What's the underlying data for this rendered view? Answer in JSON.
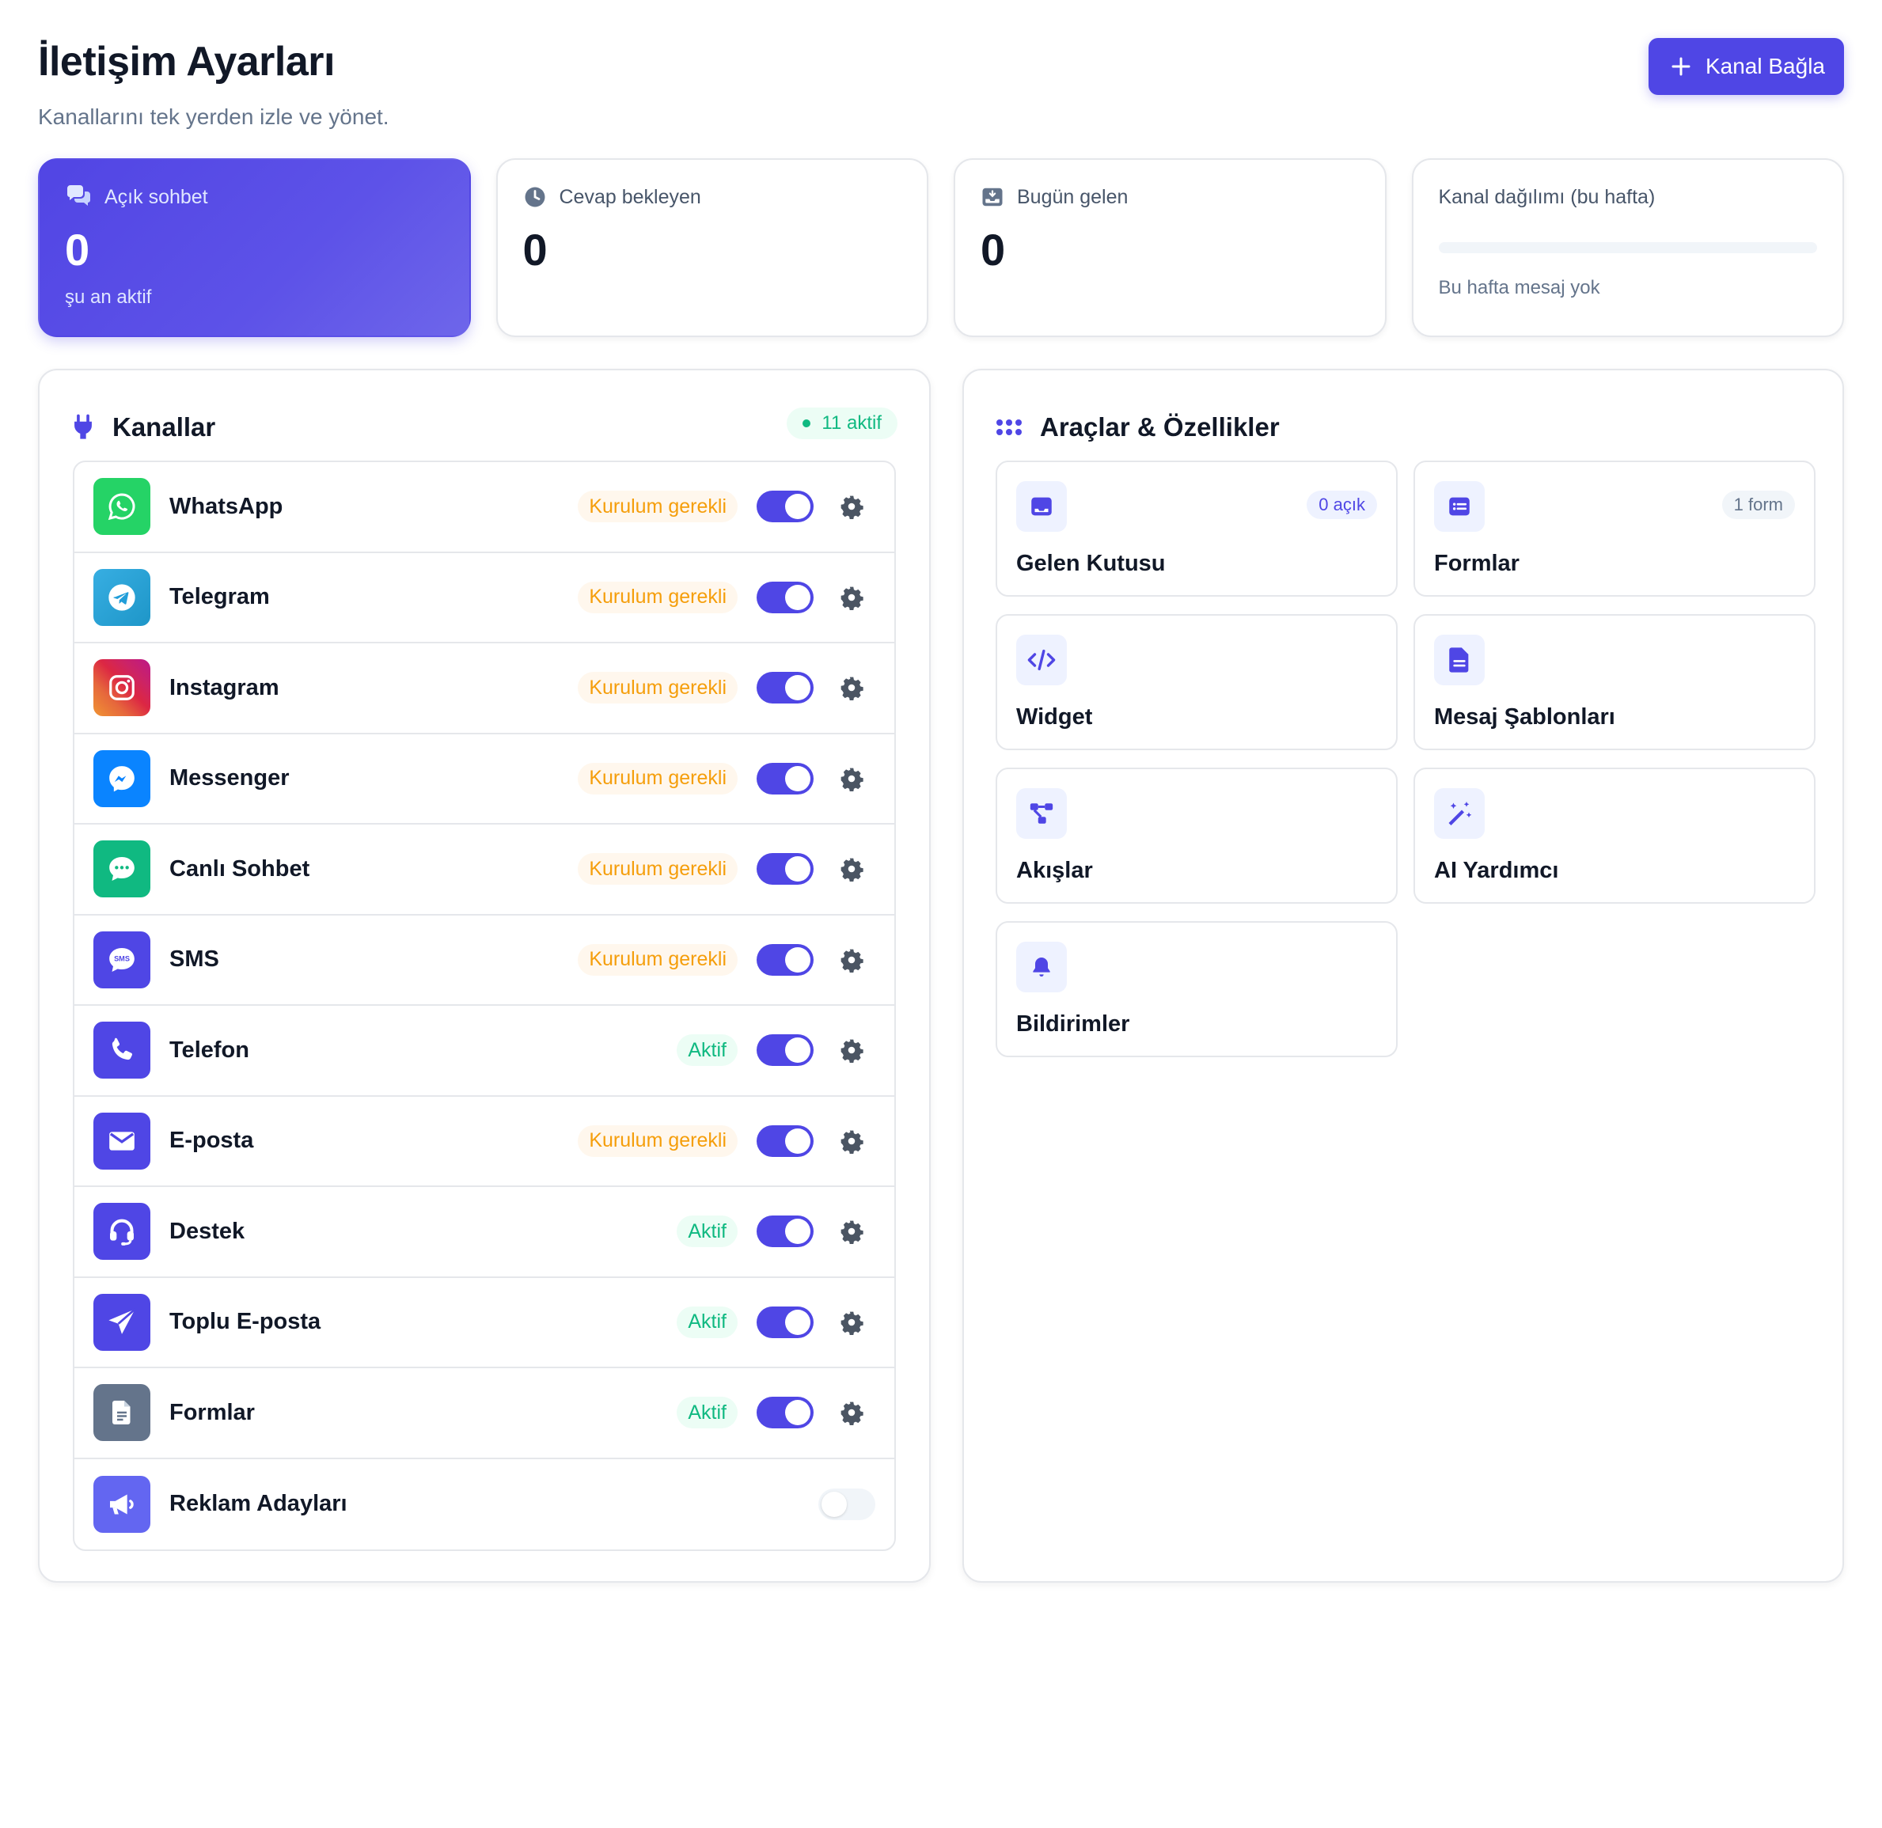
{
  "page": {
    "title": "İletişim Ayarları",
    "subtitle": "Kanallarını tek yerden izle ve yönet.",
    "connect_button": "Kanal Bağla"
  },
  "stats": {
    "open_chats": {
      "label": "Açık sohbet",
      "value": "0",
      "sub": "şu an aktif",
      "icon": "chat-bubbles-icon"
    },
    "awaiting_reply": {
      "label": "Cevap bekleyen",
      "value": "0",
      "icon": "clock-icon"
    },
    "today_incoming": {
      "label": "Bugün gelen",
      "value": "0",
      "icon": "inbox-download-icon"
    },
    "distribution": {
      "label": "Kanal dağılımı (bu hafta)",
      "empty": "Bu hafta mesaj yok"
    }
  },
  "channels": {
    "title": "Kanallar",
    "active_count": "11 aktif",
    "items": [
      {
        "name": "WhatsApp",
        "status": "Kurulum gerekli",
        "state": "setup",
        "enabled": true,
        "icon": "whatsapp-icon",
        "color": "#25d366"
      },
      {
        "name": "Telegram",
        "status": "Kurulum gerekli",
        "state": "setup",
        "enabled": true,
        "icon": "telegram-icon",
        "color": "#229ed9"
      },
      {
        "name": "Instagram",
        "status": "Kurulum gerekli",
        "state": "setup",
        "enabled": true,
        "icon": "instagram-icon",
        "color": "#e1306c"
      },
      {
        "name": "Messenger",
        "status": "Kurulum gerekli",
        "state": "setup",
        "enabled": true,
        "icon": "messenger-icon",
        "color": "#0084ff"
      },
      {
        "name": "Canlı Sohbet",
        "status": "Kurulum gerekli",
        "state": "setup",
        "enabled": true,
        "icon": "live-chat-icon",
        "color": "#10b981"
      },
      {
        "name": "SMS",
        "status": "Kurulum gerekli",
        "state": "setup",
        "enabled": true,
        "icon": "sms-icon",
        "color": "#4f46e5"
      },
      {
        "name": "Telefon",
        "status": "Aktif",
        "state": "active",
        "enabled": true,
        "icon": "phone-icon",
        "color": "#4f46e5"
      },
      {
        "name": "E-posta",
        "status": "Kurulum gerekli",
        "state": "setup",
        "enabled": true,
        "icon": "envelope-icon",
        "color": "#4f46e5"
      },
      {
        "name": "Destek",
        "status": "Aktif",
        "state": "active",
        "enabled": true,
        "icon": "headset-icon",
        "color": "#4f46e5"
      },
      {
        "name": "Toplu E-posta",
        "status": "Aktif",
        "state": "active",
        "enabled": true,
        "icon": "paper-plane-icon",
        "color": "#4f46e5"
      },
      {
        "name": "Formlar",
        "status": "Aktif",
        "state": "active",
        "enabled": true,
        "icon": "document-icon",
        "color": "#64748b"
      },
      {
        "name": "Reklam Adayları",
        "status": "",
        "state": "none",
        "enabled": false,
        "icon": "megaphone-icon",
        "color": "#6366f1"
      }
    ]
  },
  "tools": {
    "title": "Araçlar & Özellikler",
    "items": [
      {
        "name": "Gelen Kutusu",
        "badge": "0 açık",
        "icon": "inbox-icon"
      },
      {
        "name": "Formlar",
        "badge": "1 form",
        "icon": "form-list-icon"
      },
      {
        "name": "Widget",
        "badge": "",
        "icon": "code-icon"
      },
      {
        "name": "Mesaj Şablonları",
        "badge": "",
        "icon": "file-text-icon"
      },
      {
        "name": "Akışlar",
        "badge": "",
        "icon": "flow-icon"
      },
      {
        "name": "AI Yardımcı",
        "badge": "",
        "icon": "magic-wand-icon"
      },
      {
        "name": "Bildirimler",
        "badge": "",
        "icon": "bell-icon"
      }
    ]
  },
  "colors": {
    "accent": "#4f46e5",
    "success": "#10b981",
    "warning": "#f59e0b"
  }
}
